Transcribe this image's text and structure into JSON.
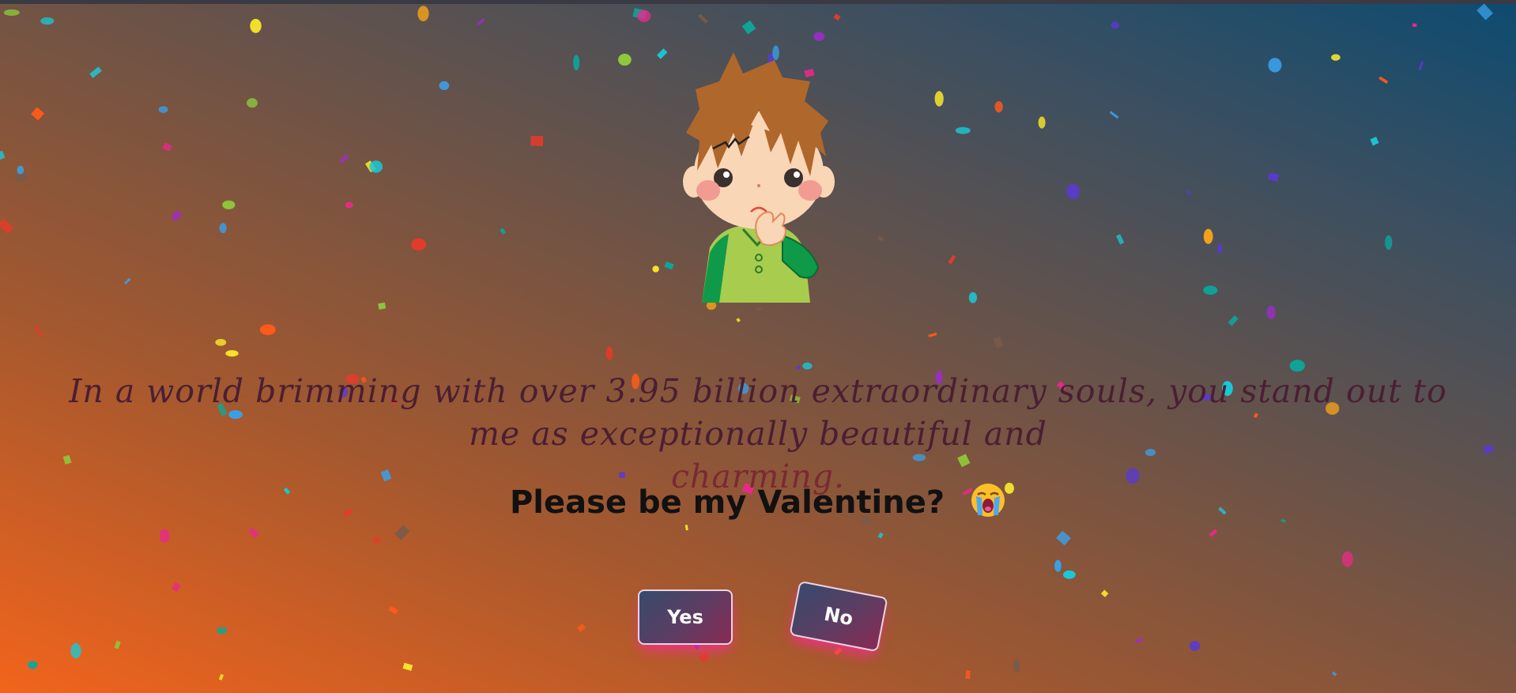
{
  "message": {
    "text": "In a world brimming with over 3.95 billion extraordinary souls, you stand out to me as exceptionally beautiful and",
    "tail": "charming."
  },
  "question": {
    "text": "Please be my Valentine?",
    "emoji_icon": "loudly-crying-face-icon"
  },
  "buttons": {
    "yes_label": "Yes",
    "no_label": "No"
  },
  "colors": {
    "button_glow": "#ff3c9a",
    "gradient_start": "#f2641c",
    "gradient_end": "#0d4b70"
  },
  "illustration": {
    "icon": "thinking-boy-character-icon"
  }
}
